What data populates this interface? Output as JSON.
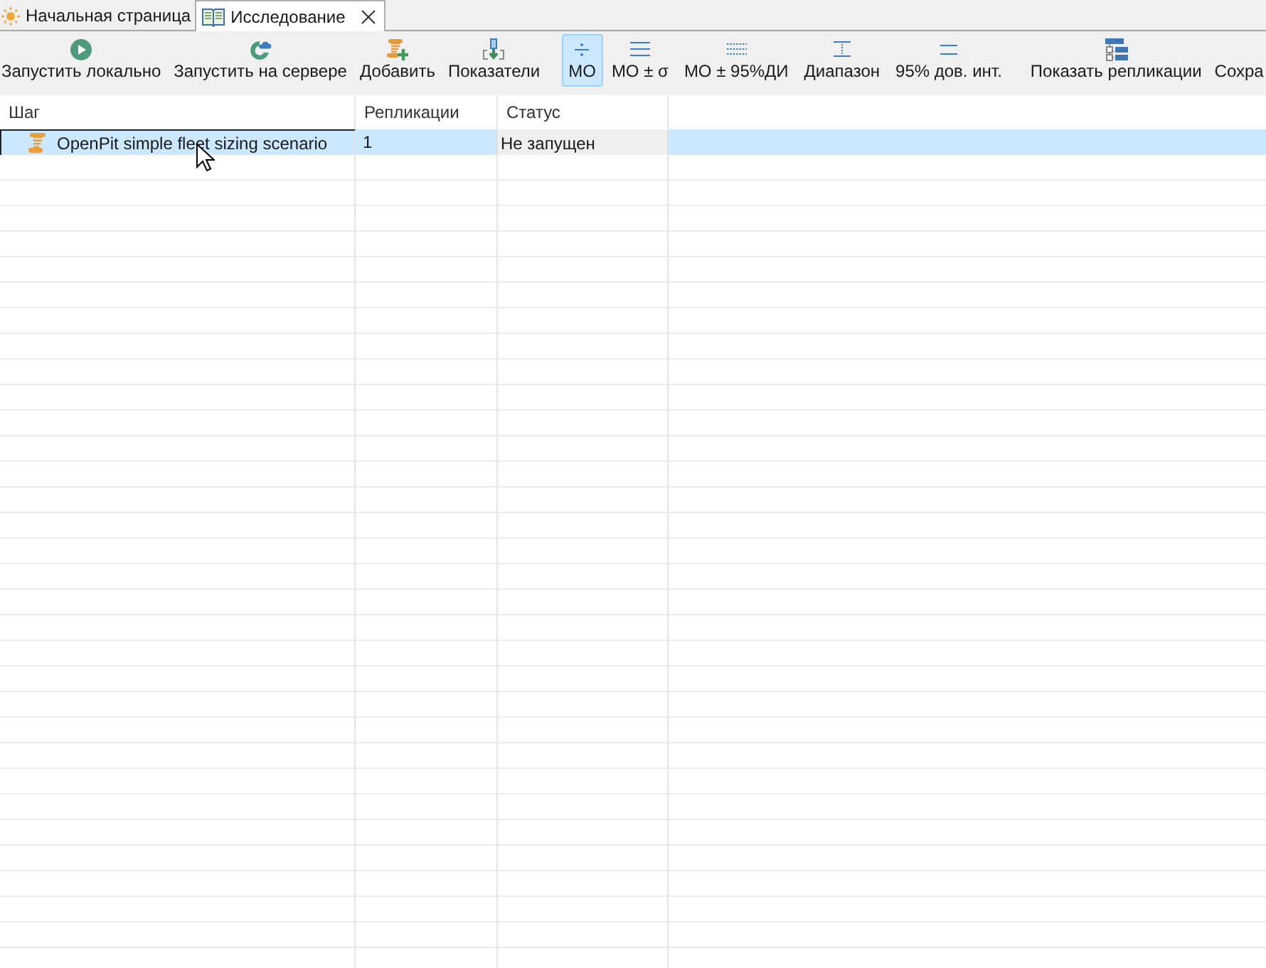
{
  "tabs": [
    {
      "label": "Начальная страница",
      "selected": false,
      "closable": false
    },
    {
      "label": "Исследование",
      "selected": true,
      "closable": true
    }
  ],
  "toolbar": [
    {
      "label": "Запустить локально",
      "kind": "action"
    },
    {
      "label": "Запустить на сервере",
      "kind": "action"
    },
    {
      "label": "Добавить",
      "kind": "action"
    },
    {
      "label": "Показатели",
      "kind": "action"
    },
    {
      "label": "МО",
      "kind": "toggle",
      "selected": true
    },
    {
      "label": "МО ± σ",
      "kind": "toggle",
      "selected": false
    },
    {
      "label": "МО ± 95%ДИ",
      "kind": "toggle",
      "selected": false
    },
    {
      "label": "Диапазон",
      "kind": "toggle",
      "selected": false
    },
    {
      "label": "95% дов. инт.",
      "kind": "toggle",
      "selected": false
    },
    {
      "label": "Показать репликации",
      "kind": "action"
    },
    {
      "label": "Сохра",
      "kind": "action"
    }
  ],
  "table": {
    "columns": [
      "Шаг",
      "Репликации",
      "Статус"
    ],
    "rows": [
      {
        "step": "OpenPit simple fleet sizing scenario",
        "replications": "1",
        "status": "Не запущен",
        "selected": true
      }
    ]
  }
}
